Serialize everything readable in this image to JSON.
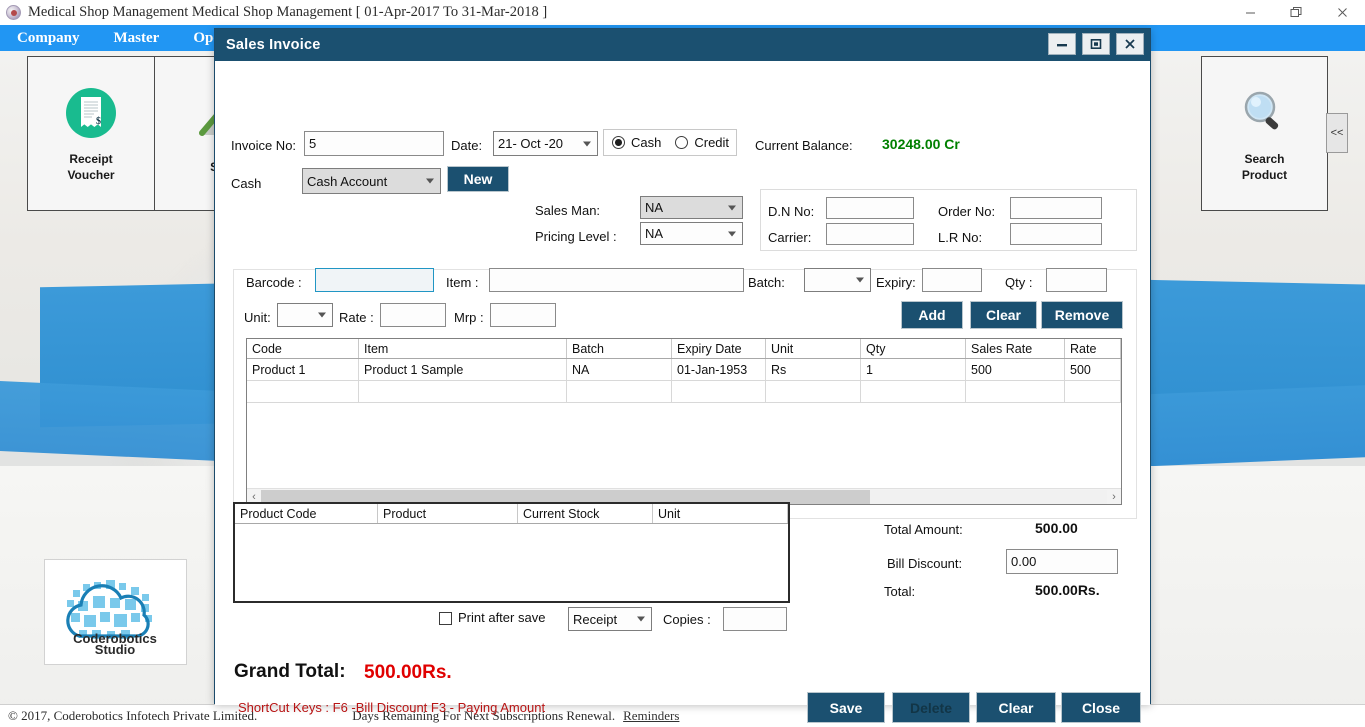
{
  "main_window": {
    "title": "Medical Shop Management Medical Shop Management [ 01-Apr-2017 To 31-Mar-2018 ]",
    "icon": "app-icon",
    "minimize": "–",
    "maximize": "❐",
    "close": "✕"
  },
  "menu": {
    "items": [
      {
        "label": "Company"
      },
      {
        "label": "Master"
      },
      {
        "label": "Opera"
      }
    ]
  },
  "tiles": [
    {
      "label_line1": "Receipt",
      "label_line2": "Voucher",
      "icon": "receipt-icon"
    },
    {
      "label_line1": "Sa",
      "label_line2": "",
      "icon": "chart-icon"
    }
  ],
  "tiles_right": [
    {
      "label_line1": "Search",
      "label_line2": "Product",
      "icon": "magnifier-icon"
    }
  ],
  "collapse_button": {
    "label": "<<"
  },
  "logo": {
    "line1": "Coderobotics",
    "line2": "Studio"
  },
  "status_bar": {
    "copyright": "© 2017, Coderobotics Infotech Private Limited.",
    "days_text": "Days Remaining For Next Subscriptions Renewal.",
    "link": "Reminders"
  },
  "dialog": {
    "title": "Sales Invoice",
    "window_buttons": {
      "minimize": "minimize-icon",
      "maximize": "maximize-icon",
      "close": "close-icon"
    },
    "header": {
      "invoice_no_label": "Invoice No:",
      "invoice_no_value": "5",
      "date_label": "Date:",
      "date_value": "21- Oct -20",
      "payment_cash": "Cash",
      "payment_credit": "Credit",
      "payment_selected": "Cash",
      "current_balance_label": "Current Balance:",
      "current_balance_value": "30248.00 Cr",
      "cash_label": "Cash",
      "account_value": "Cash Account",
      "new_button": "New",
      "sales_man_label": "Sales Man:",
      "sales_man_value": "NA",
      "pricing_level_label": "Pricing Level :",
      "pricing_level_value": "NA",
      "dn_no_label": "D.N No:",
      "dn_no_value": "",
      "order_no_label": "Order No:",
      "order_no_value": "",
      "carrier_label": "Carrier:",
      "carrier_value": "",
      "lr_no_label": "L.R No:",
      "lr_no_value": ""
    },
    "entry": {
      "barcode_label": "Barcode :",
      "barcode_value": "",
      "item_label": "Item :",
      "item_value": "",
      "batch_label": "Batch:",
      "batch_value": "",
      "expiry_label": "Expiry:",
      "expiry_value": "",
      "qty_label": "Qty :",
      "qty_value": "",
      "unit_label": "Unit:",
      "unit_value": "",
      "rate_label": "Rate :",
      "rate_value": "",
      "mrp_label": "Mrp :",
      "mrp_value": "",
      "add_button": "Add",
      "clear_button": "Clear",
      "remove_button": "Remove"
    },
    "items_grid": {
      "columns": [
        "Code",
        "Item",
        "Batch",
        "Expiry Date",
        "Unit",
        "Qty",
        "Sales Rate",
        "Rate"
      ],
      "rows": [
        [
          "Product 1",
          "Product  1 Sample",
          "NA",
          "01-Jan-1953",
          "Rs",
          "1",
          "500",
          "500"
        ]
      ],
      "scroll_left": "‹",
      "scroll_right": "›"
    },
    "stock_grid": {
      "columns": [
        "Product Code",
        "Product",
        "Current Stock",
        "Unit"
      ],
      "rows": []
    },
    "totals": {
      "total_amount_label": "Total Amount:",
      "total_amount_value": "500.00",
      "bill_discount_label": "Bill Discount:",
      "bill_discount_value": "0.00",
      "total_label": "Total:",
      "total_value": "500.00Rs."
    },
    "print": {
      "print_after_save_label": "Print after save",
      "print_after_save_checked": false,
      "format_value": "Receipt",
      "copies_label": "Copies :",
      "copies_value": ""
    },
    "grand": {
      "label": "Grand Total:",
      "value": "500.00Rs."
    },
    "shortcuts": "ShortCut Keys :  F6 -Bill Discount   F3 - Paying Amount",
    "buttons": {
      "save": "Save",
      "delete": "Delete",
      "clear": "Clear",
      "close": "Close"
    }
  },
  "colors": {
    "dialog_title_bg": "#1b5070",
    "menu_bg": "#2196f3",
    "accent_button": "#1b5070",
    "balance_green": "#008000",
    "grand_total_red": "#e00000",
    "shortcut_red": "#b81414"
  }
}
